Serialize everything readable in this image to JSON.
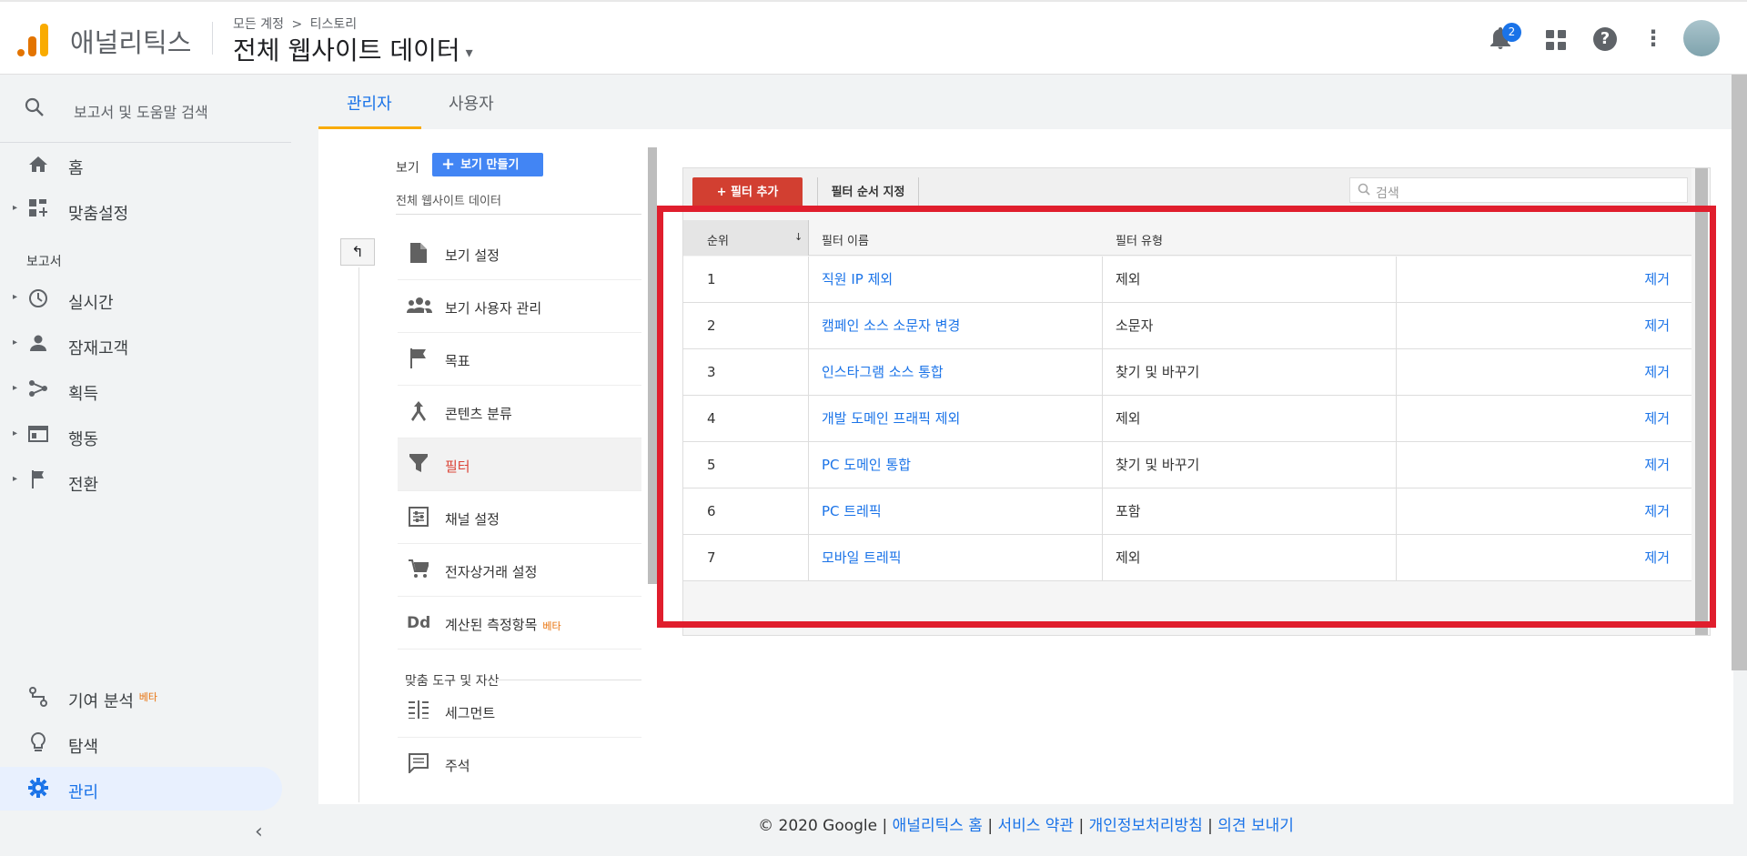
{
  "header": {
    "brand": "애널리틱스",
    "breadcrumb_account": "모든 계정",
    "breadcrumb_arrow": ">",
    "breadcrumb_property": "티스토리",
    "view_name": "전체 웹사이트 데이터",
    "notification_count": "2",
    "help_glyph": "?",
    "kebab_glyph": "⋮"
  },
  "sidebar": {
    "search_placeholder": "보고서 및 도움말 검색",
    "home": "홈",
    "custom": "맞춤설정",
    "section_reports": "보고서",
    "realtime": "실시간",
    "audience": "잠재고객",
    "acquisition": "획득",
    "behavior": "행동",
    "conversions": "전환",
    "attribution": "기여 분석",
    "attribution_beta": "베타",
    "discover": "탐색",
    "admin": "관리"
  },
  "tabs": {
    "admin": "관리자",
    "user": "사용자"
  },
  "view_panel": {
    "view_label": "보기",
    "create_view": "보기 만들기",
    "view_name": "전체 웹사이트 데이터",
    "items": [
      {
        "label": "보기 설정",
        "icon": "document-icon"
      },
      {
        "label": "보기 사용자 관리",
        "icon": "people-icon"
      },
      {
        "label": "목표",
        "icon": "flag-icon"
      },
      {
        "label": "콘텐츠 분류",
        "icon": "content-grouping-icon"
      },
      {
        "label": "필터",
        "icon": "filter-icon"
      },
      {
        "label": "채널 설정",
        "icon": "channel-settings-icon"
      },
      {
        "label": "전자상거래 설정",
        "icon": "cart-icon"
      },
      {
        "label": "계산된 측정항목",
        "icon": "dd-icon",
        "beta": "베타"
      }
    ],
    "tools_header": "맞춤 도구 및 자산",
    "tools": [
      {
        "label": "세그먼트",
        "icon": "segment-icon"
      },
      {
        "label": "주석",
        "icon": "annotation-icon"
      }
    ]
  },
  "filters": {
    "add_button": "+ 필터 추가",
    "order_button": "필터 순서 지정",
    "search_placeholder": "검색",
    "columns": {
      "rank": "순위",
      "name": "필터 이름",
      "type": "필터 유형"
    },
    "sort_glyph": "↓",
    "remove_label": "제거",
    "rows": [
      {
        "rank": "1",
        "name": "직원 IP 제외",
        "type": "제외"
      },
      {
        "rank": "2",
        "name": "캠페인 소스 소문자 변경",
        "type": "소문자"
      },
      {
        "rank": "3",
        "name": "인스타그램 소스 통합",
        "type": "찾기 및 바꾸기"
      },
      {
        "rank": "4",
        "name": "개발 도메인 프래픽 제외",
        "type": "제외"
      },
      {
        "rank": "5",
        "name": "PC 도메인 통합",
        "type": "찾기 및 바꾸기"
      },
      {
        "rank": "6",
        "name": "PC 트레픽",
        "type": "포함"
      },
      {
        "rank": "7",
        "name": "모바일 트레픽",
        "type": "제외"
      }
    ]
  },
  "footer": {
    "copyright": "© 2020 Google",
    "sep": "|",
    "link_home": "애널리틱스 홈",
    "link_terms": "서비스 약관",
    "link_privacy": "개인정보처리방침",
    "link_feedback": "의견 보내기"
  },
  "colors": {
    "accent": "#1a73e8",
    "filter_red": "#d23f31",
    "highlight": "#e01e2d",
    "tab_underline": "#f9ab00"
  }
}
